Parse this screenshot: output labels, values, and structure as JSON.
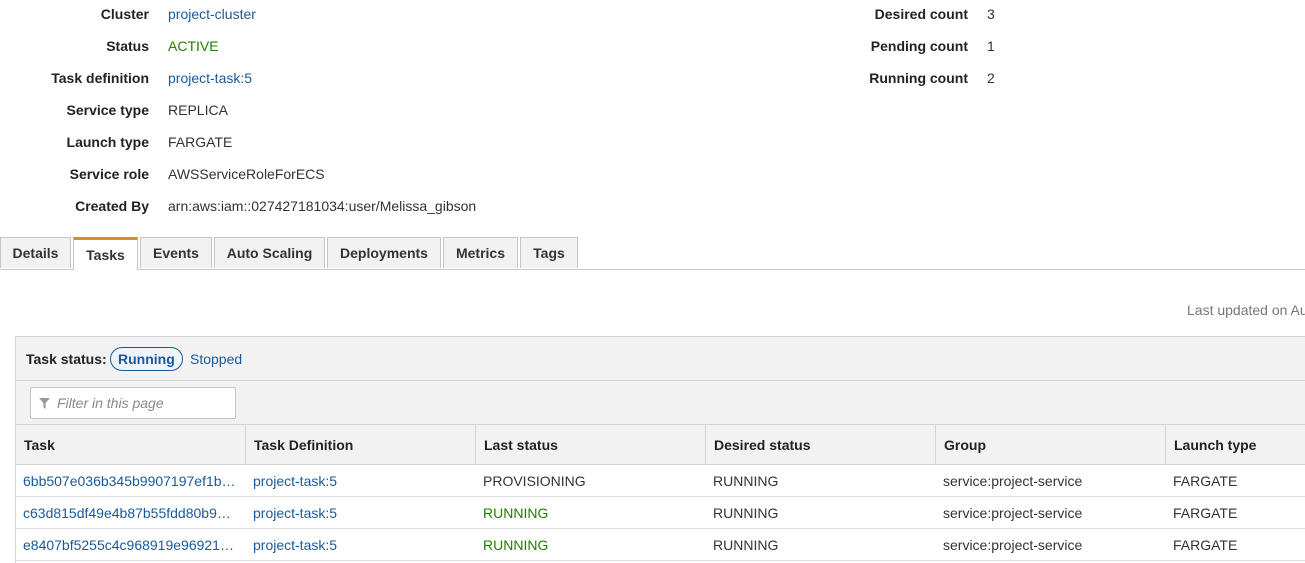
{
  "summary": {
    "cluster": {
      "label": "Cluster",
      "value": "project-cluster"
    },
    "status": {
      "label": "Status",
      "value": "ACTIVE"
    },
    "task_definition": {
      "label": "Task definition",
      "value": "project-task:5"
    },
    "service_type": {
      "label": "Service type",
      "value": "REPLICA"
    },
    "launch_type": {
      "label": "Launch type",
      "value": "FARGATE"
    },
    "service_role": {
      "label": "Service role",
      "value": "AWSServiceRoleForECS"
    },
    "created_by": {
      "label": "Created By",
      "value": "arn:aws:iam::027427181034:user/Melissa_gibson"
    },
    "desired_count": {
      "label": "Desired count",
      "value": "3"
    },
    "pending_count": {
      "label": "Pending count",
      "value": "1"
    },
    "running_count": {
      "label": "Running count",
      "value": "2"
    }
  },
  "tabs": [
    {
      "label": "Details"
    },
    {
      "label": "Tasks"
    },
    {
      "label": "Events"
    },
    {
      "label": "Auto Scaling"
    },
    {
      "label": "Deployments"
    },
    {
      "label": "Metrics"
    },
    {
      "label": "Tags"
    }
  ],
  "active_tab": "Tasks",
  "last_updated": "Last updated on Au",
  "task_status": {
    "label": "Task status:",
    "running": "Running",
    "stopped": "Stopped"
  },
  "filter": {
    "placeholder": "Filter in this page",
    "icon": "filter-icon"
  },
  "table": {
    "headers": [
      "Task",
      "Task Definition",
      "Last status",
      "Desired status",
      "Group",
      "Launch type"
    ],
    "rows": [
      [
        "6bb507e036b345b9907197ef1b…",
        "project-task:5",
        "PROVISIONING",
        "RUNNING",
        "service:project-service",
        "FARGATE"
      ],
      [
        "c63d815df49e4b87b55fdd80b9…",
        "project-task:5",
        "RUNNING",
        "RUNNING",
        "service:project-service",
        "FARGATE"
      ],
      [
        "e8407bf5255c4c968919e96921…",
        "project-task:5",
        "RUNNING",
        "RUNNING",
        "service:project-service",
        "FARGATE"
      ]
    ]
  },
  "colors": {
    "link": "#1a5a99",
    "running_green": "#1d8102",
    "active_tab_accent": "#e38b1a",
    "header_bg": "#f2f2f2"
  }
}
